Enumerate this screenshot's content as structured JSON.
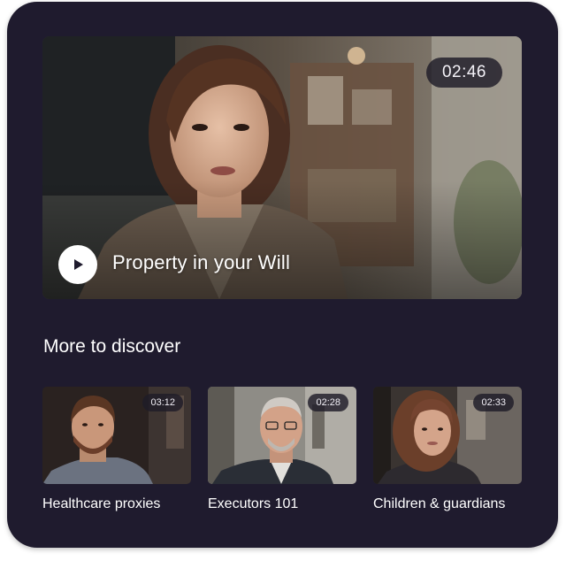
{
  "featured": {
    "title": "Property in your Will",
    "duration": "02:46",
    "play_icon": "play-icon"
  },
  "more": {
    "heading": "More to discover",
    "videos": [
      {
        "title": "Healthcare proxies",
        "duration": "03:12"
      },
      {
        "title": "Executors 101",
        "duration": "02:28"
      },
      {
        "title": "Children & guardians",
        "duration": "02:33"
      }
    ]
  },
  "colors": {
    "card_background": "#1f1b2e",
    "text": "#ffffff",
    "pill_background": "#1e1c28"
  }
}
